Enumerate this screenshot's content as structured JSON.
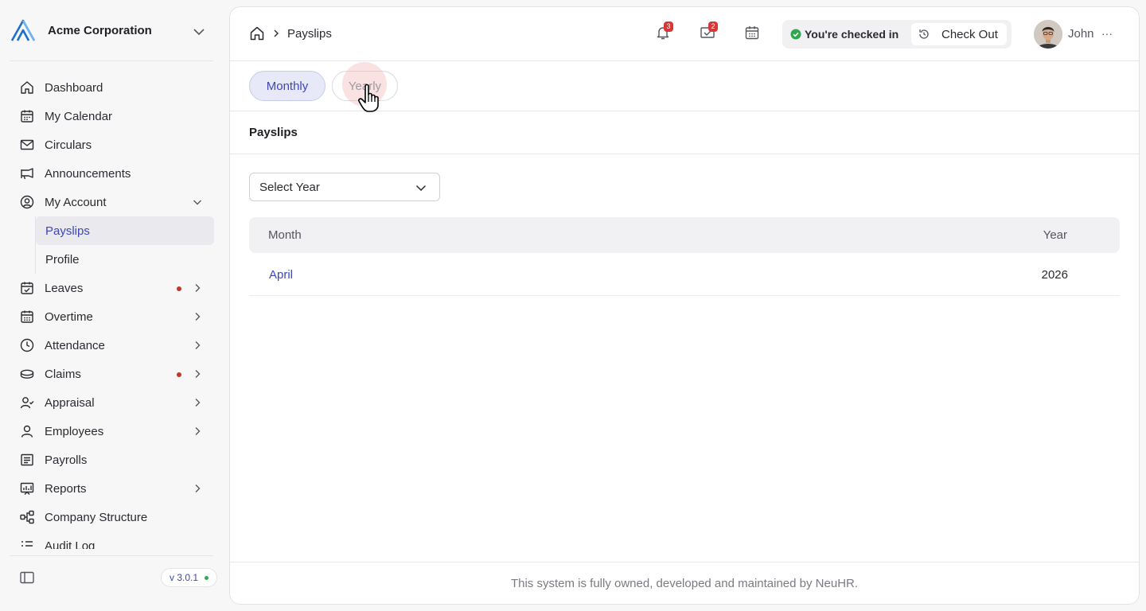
{
  "app": {
    "org_name": "Acme Corporation",
    "version": "v 3.0.1"
  },
  "sidebar": {
    "items": [
      {
        "label": "Dashboard",
        "icon": "home-icon"
      },
      {
        "label": "My Calendar",
        "icon": "calendar-icon"
      },
      {
        "label": "Circulars",
        "icon": "mail-icon"
      },
      {
        "label": "Announcements",
        "icon": "megaphone-icon"
      },
      {
        "label": "My Account",
        "icon": "user-circle-icon",
        "expanded": true,
        "children": [
          {
            "label": "Payslips",
            "active": true
          },
          {
            "label": "Profile"
          }
        ]
      },
      {
        "label": "Leaves",
        "icon": "calendar-check-icon",
        "has_dot": true,
        "dot_color": "#c0392b"
      },
      {
        "label": "Overtime",
        "icon": "calendar-grid-icon"
      },
      {
        "label": "Attendance",
        "icon": "clock-icon"
      },
      {
        "label": "Claims",
        "icon": "coins-icon",
        "has_dot": true,
        "dot_color": "#c0392b"
      },
      {
        "label": "Appraisal",
        "icon": "user-check-icon"
      },
      {
        "label": "Employees",
        "icon": "user-icon"
      },
      {
        "label": "Payrolls",
        "icon": "receipt-icon"
      },
      {
        "label": "Reports",
        "icon": "chart-board-icon"
      },
      {
        "label": "Company Structure",
        "icon": "hierarchy-icon"
      },
      {
        "label": "Audit Log",
        "icon": "list-icon"
      }
    ]
  },
  "header": {
    "breadcrumb": "Payslips",
    "notifications_count": "3",
    "inbox_count": "2",
    "checkin_status": "You're checked in",
    "checkout_label": "Check Out",
    "user_name": "John",
    "more": "···"
  },
  "tabs": {
    "monthly": "Monthly",
    "yearly": "Yearly",
    "active": "Monthly"
  },
  "content": {
    "section_title": "Payslips",
    "year_select": "Select Year",
    "table": {
      "columns": [
        "Month",
        "Year"
      ],
      "rows": [
        {
          "month": "April",
          "year": "2026"
        }
      ]
    }
  },
  "footer": {
    "text": "This system is fully owned, developed and maintained by NeuHR."
  },
  "colors": {
    "accent": "#3d47b8",
    "alert": "#d93636",
    "success": "#2fa84f"
  }
}
